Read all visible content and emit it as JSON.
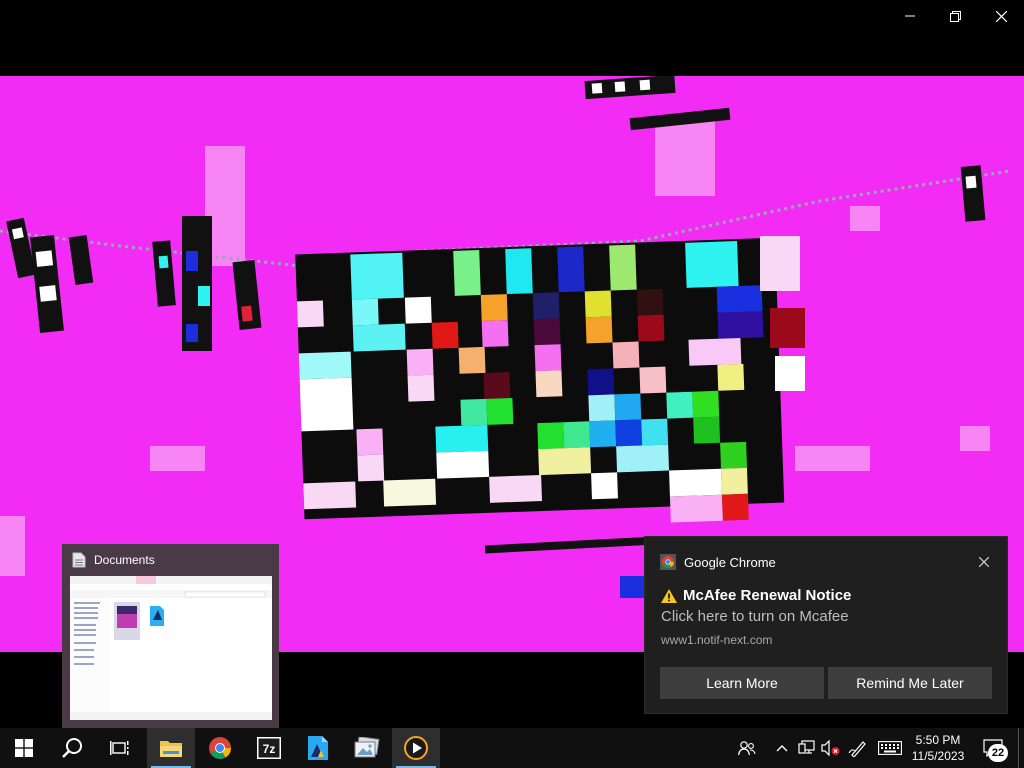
{
  "thumbnail": {
    "title": "Documents"
  },
  "toast": {
    "app_name": "Google Chrome",
    "title": "McAfee Renewal Notice",
    "body": "Click here to turn on Mcafee",
    "source": "www1.notif-next.com",
    "primary_button": "Learn More",
    "secondary_button": "Remind Me Later"
  },
  "taskbar": {
    "apps": [
      {
        "name": "start-icon"
      },
      {
        "name": "search-icon"
      },
      {
        "name": "task-view-icon"
      },
      {
        "name": "file-explorer-icon"
      },
      {
        "name": "chrome-icon"
      },
      {
        "name": "7zip-icon"
      },
      {
        "name": "video-editor-icon"
      },
      {
        "name": "image-viewer-icon"
      },
      {
        "name": "media-player-icon"
      }
    ],
    "clock_time": "5:50 PM",
    "clock_date": "11/5/2023",
    "notification_count": "22"
  },
  "colors": {
    "video_background": "#f22cf4",
    "accent": "#76b9ed",
    "toast_background": "#1f1f1f",
    "toast_button": "#3e3e3e"
  }
}
